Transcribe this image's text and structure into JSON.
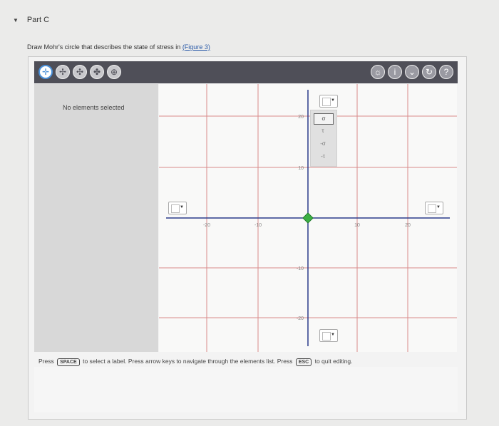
{
  "part": {
    "title": "Part C",
    "caret_icon": "triangle-down-icon"
  },
  "instruction": {
    "text": "Draw Mohr's circle that describes the state of stress in ",
    "link": "(Figure 3)"
  },
  "toolbar": {
    "left_tools": [
      "select-tool",
      "point-tool",
      "line-tool",
      "axis-tool",
      "circle-tool"
    ],
    "right_tools": [
      "hint-icon",
      "info-icon",
      "dropdown-icon",
      "reset-icon",
      "help-icon"
    ],
    "help_label": "?"
  },
  "sidebar": {
    "empty_label": "No elements selected"
  },
  "graph": {
    "x_ticks": [
      "-20",
      "-10",
      "10",
      "20"
    ],
    "y_ticks": [
      "20",
      "10",
      "-10",
      "-20"
    ],
    "origin_color": "#3cb043",
    "axis_color": "#2b3a8a",
    "grid_color": "#d98a8a"
  },
  "palette": {
    "items": [
      "σ",
      "τ",
      "-σ",
      "-τ"
    ]
  },
  "hint": {
    "pre": "Press",
    "key1": "SPACE",
    "mid": "to select a label. Press arrow keys to navigate through the elements list. Press",
    "key2": "ESC",
    "post": "to quit editing."
  }
}
